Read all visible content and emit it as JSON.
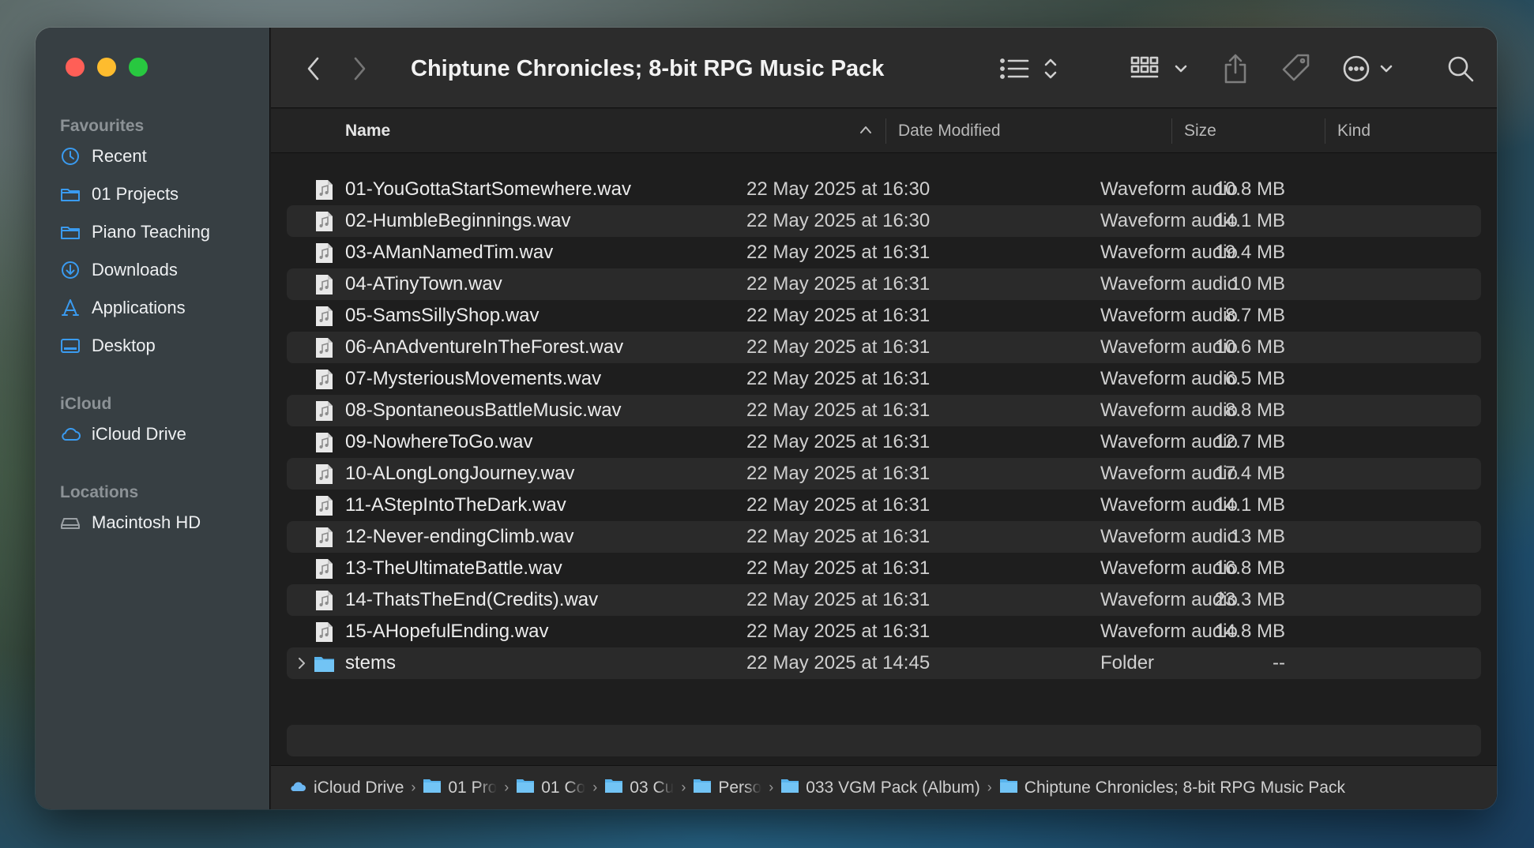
{
  "window": {
    "title": "Chiptune Chronicles; 8-bit RPG Music Pack"
  },
  "sidebar": {
    "favourites_label": "Favourites",
    "favourites": [
      {
        "label": "Recent",
        "icon": "clock-icon"
      },
      {
        "label": "01 Projects",
        "icon": "folder-icon"
      },
      {
        "label": "Piano Teaching",
        "icon": "folder-icon"
      },
      {
        "label": "Downloads",
        "icon": "download-icon"
      },
      {
        "label": "Applications",
        "icon": "applications-icon"
      },
      {
        "label": "Desktop",
        "icon": "desktop-icon"
      }
    ],
    "icloud_label": "iCloud",
    "icloud": [
      {
        "label": "iCloud Drive",
        "icon": "cloud-icon"
      }
    ],
    "locations_label": "Locations",
    "locations": [
      {
        "label": "Macintosh HD",
        "icon": "disk-icon"
      }
    ]
  },
  "columns": {
    "name": "Name",
    "date": "Date Modified",
    "size": "Size",
    "kind": "Kind"
  },
  "files": [
    {
      "name": "01-YouGottaStartSomewhere.wav",
      "date": "22 May 2025 at 16:30",
      "size": "10.8 MB",
      "kind": "Waveform audio"
    },
    {
      "name": "02-HumbleBeginnings.wav",
      "date": "22 May 2025 at 16:30",
      "size": "14.1 MB",
      "kind": "Waveform audio"
    },
    {
      "name": "03-AManNamedTim.wav",
      "date": "22 May 2025 at 16:31",
      "size": "19.4 MB",
      "kind": "Waveform audio"
    },
    {
      "name": "04-ATinyTown.wav",
      "date": "22 May 2025 at 16:31",
      "size": "10 MB",
      "kind": "Waveform audio"
    },
    {
      "name": "05-SamsSillyShop.wav",
      "date": "22 May 2025 at 16:31",
      "size": "8.7 MB",
      "kind": "Waveform audio"
    },
    {
      "name": "06-AnAdventureInTheForest.wav",
      "date": "22 May 2025 at 16:31",
      "size": "10.6 MB",
      "kind": "Waveform audio"
    },
    {
      "name": "07-MysteriousMovements.wav",
      "date": "22 May 2025 at 16:31",
      "size": "6.5 MB",
      "kind": "Waveform audio"
    },
    {
      "name": "08-SpontaneousBattleMusic.wav",
      "date": "22 May 2025 at 16:31",
      "size": "8.8 MB",
      "kind": "Waveform audio"
    },
    {
      "name": "09-NowhereToGo.wav",
      "date": "22 May 2025 at 16:31",
      "size": "12.7 MB",
      "kind": "Waveform audio"
    },
    {
      "name": "10-ALongLongJourney.wav",
      "date": "22 May 2025 at 16:31",
      "size": "17.4 MB",
      "kind": "Waveform audio"
    },
    {
      "name": "11-AStepIntoTheDark.wav",
      "date": "22 May 2025 at 16:31",
      "size": "14.1 MB",
      "kind": "Waveform audio"
    },
    {
      "name": "12-Never-endingClimb.wav",
      "date": "22 May 2025 at 16:31",
      "size": "13 MB",
      "kind": "Waveform audio"
    },
    {
      "name": "13-TheUltimateBattle.wav",
      "date": "22 May 2025 at 16:31",
      "size": "16.8 MB",
      "kind": "Waveform audio"
    },
    {
      "name": "14-ThatsTheEnd(Credits).wav",
      "date": "22 May 2025 at 16:31",
      "size": "23.3 MB",
      "kind": "Waveform audio"
    },
    {
      "name": "15-AHopefulEnding.wav",
      "date": "22 May 2025 at 16:31",
      "size": "14.8 MB",
      "kind": "Waveform audio"
    },
    {
      "name": "stems",
      "date": "22 May 2025 at 14:45",
      "size": "--",
      "kind": "Folder",
      "is_folder": true
    }
  ],
  "pathbar": [
    {
      "label": "iCloud Drive",
      "icon": "cloud-icon"
    },
    {
      "label": "01 Pro",
      "icon": "folder-icon",
      "truncated": true
    },
    {
      "label": "01 Co",
      "icon": "folder-icon",
      "truncated": true
    },
    {
      "label": "03 Cu",
      "icon": "folder-icon",
      "truncated": true
    },
    {
      "label": "Perso",
      "icon": "folder-icon",
      "truncated": true
    },
    {
      "label": "033 VGM Pack (Album)",
      "icon": "folder-icon"
    },
    {
      "label": "Chiptune Chronicles; 8-bit RPG Music Pack",
      "icon": "folder-icon"
    }
  ],
  "colors": {
    "accent": "#3a9bf0",
    "close": "#ff5f57",
    "minimize": "#febc2e",
    "maximize": "#28c840"
  }
}
